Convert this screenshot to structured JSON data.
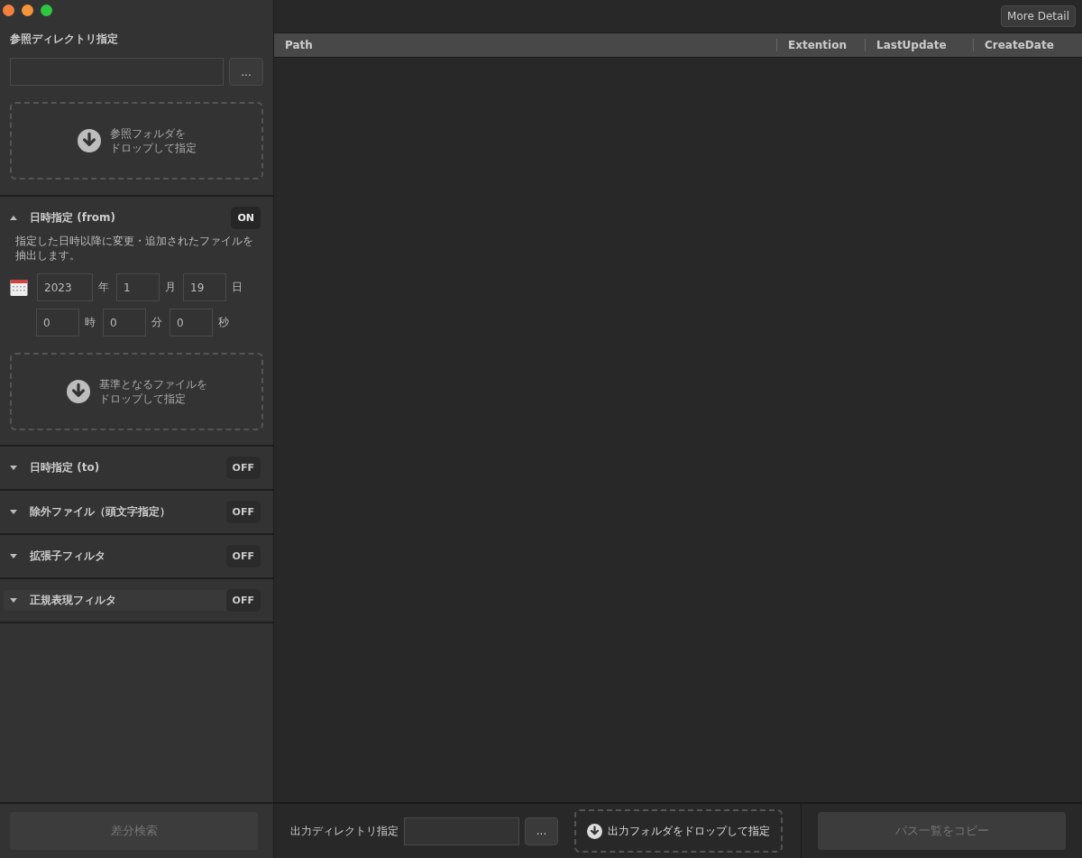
{
  "window": {
    "controls": [
      {
        "color": "#f5803e"
      },
      {
        "color": "#f6953a"
      },
      {
        "color": "#2ec840"
      }
    ]
  },
  "reference": {
    "label": "参照ディレクトリ指定",
    "browse_button": "...",
    "drop_zone": [
      "参照フォルダを",
      "ドロップして指定"
    ]
  },
  "sections": [
    {
      "title": "日時指定 (from)",
      "expanded": true,
      "on": true,
      "toggle": "ON",
      "selected": false,
      "description": "指定した日時以降に変更・追加されたファイルを抽出します。",
      "date_row": [
        {
          "value": "2023",
          "unit": "年"
        },
        {
          "value": "1",
          "unit": "月"
        },
        {
          "value": "19",
          "unit": "日"
        }
      ],
      "time_row": [
        {
          "value": "0",
          "unit": "時"
        },
        {
          "value": "0",
          "unit": "分"
        },
        {
          "value": "0",
          "unit": "秒"
        }
      ],
      "drop_zone": [
        "基準となるファイルを",
        "ドロップして指定"
      ]
    },
    {
      "title": "日時指定 (to)",
      "expanded": false,
      "on": false,
      "toggle": "OFF",
      "selected": false
    },
    {
      "title": "除外ファイル（頭文字指定）",
      "expanded": false,
      "on": false,
      "toggle": "OFF",
      "selected": false
    },
    {
      "title": "拡張子フィルタ",
      "expanded": false,
      "on": false,
      "toggle": "OFF",
      "selected": false
    },
    {
      "title": "正規表現フィルタ",
      "expanded": false,
      "on": false,
      "toggle": "OFF",
      "selected": true
    }
  ],
  "search_button": {
    "label": "差分検索",
    "disabled": true
  },
  "more_detail_button": "More Detail",
  "table": {
    "columns": [
      "Path",
      "Extention",
      "LastUpdate",
      "CreateDate"
    ]
  },
  "output": {
    "label": "出力ディレクトリ指定",
    "browse_button": "...",
    "drop_zone": "出力フォルダをドロップして指定"
  },
  "copy_button": {
    "label": "パス一覧をコピー",
    "disabled": true
  }
}
